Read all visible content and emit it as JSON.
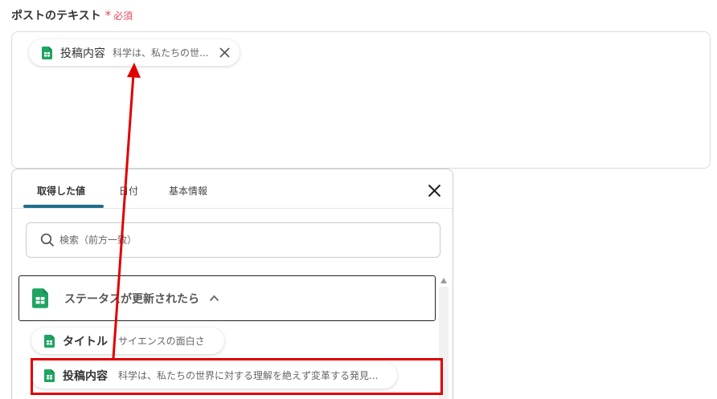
{
  "field": {
    "label": "ポストのテキスト",
    "required_mark": "*",
    "required_text": "必須"
  },
  "selected_chip": {
    "name": "投稿内容",
    "value": "科学は、私たちの世..."
  },
  "panel": {
    "tabs": [
      {
        "label": "取得した値"
      },
      {
        "label": "日付"
      },
      {
        "label": "基本情報"
      }
    ],
    "search_placeholder": "検索（前方一致）",
    "group_label": "ステータスが更新されたら",
    "items": [
      {
        "name": "タイトル",
        "value": "サイエンスの面白さ"
      },
      {
        "name": "投稿内容",
        "value": "科学は、私たちの世界に対する理解を絶えず変革する発見..."
      }
    ]
  },
  "colors": {
    "accent": "#1f6e8c",
    "required": "#e8475b",
    "annotation": "#e00000",
    "sheet_green": "#1fa463"
  },
  "icons": [
    "spreadsheet-icon",
    "close-icon",
    "search-icon",
    "chevron-up-icon",
    "scroll-up-arrow"
  ]
}
